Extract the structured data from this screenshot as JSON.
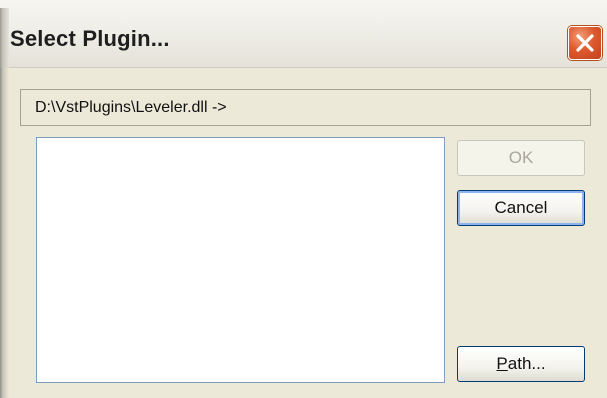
{
  "window": {
    "title": "Select Plugin...",
    "close_icon": "close-icon",
    "close_color": "#d9532c"
  },
  "path_field": {
    "value": "D:\\VstPlugins\\Leveler.dll ->"
  },
  "plugin_list": {
    "items": []
  },
  "buttons": {
    "ok": {
      "label": "OK",
      "enabled": false
    },
    "cancel": {
      "label": "Cancel",
      "enabled": true
    },
    "path": {
      "label_mnemonic": "P",
      "label_rest": "ath...",
      "enabled": true
    }
  },
  "colors": {
    "dialog_bg": "#ece9d8",
    "list_border": "#7f9db9",
    "button_border": "#003c74"
  }
}
